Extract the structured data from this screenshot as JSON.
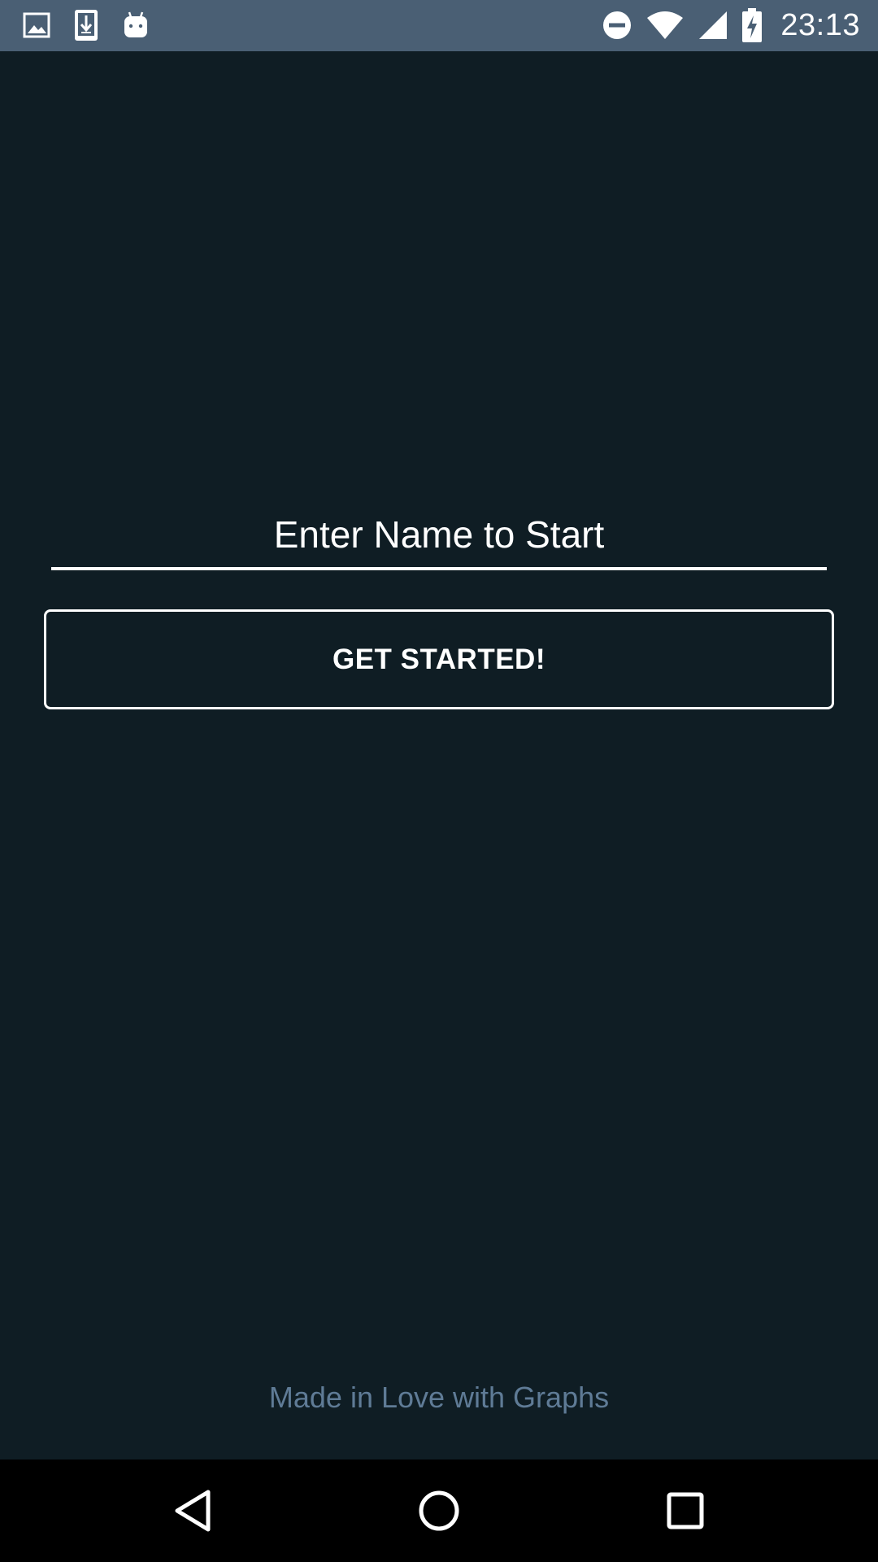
{
  "status_bar": {
    "time": "23:13",
    "background": "#4a5f74",
    "left_icons": [
      "image-icon",
      "download-icon",
      "android-icon"
    ],
    "right_icons": [
      "do-not-disturb-icon",
      "wifi-icon",
      "cell-signal-icon",
      "battery-charging-icon"
    ]
  },
  "main": {
    "name_input": {
      "placeholder": "Enter Name to Start",
      "value": ""
    },
    "start_button_label": "GET STARTED!",
    "footer_text": "Made in Love with Graphs"
  },
  "nav_bar": {
    "buttons": [
      "back-icon",
      "home-icon",
      "recents-icon"
    ]
  },
  "colors": {
    "background": "#0f1d24",
    "foreground": "#ffffff",
    "footer_text": "#5f7b96"
  }
}
